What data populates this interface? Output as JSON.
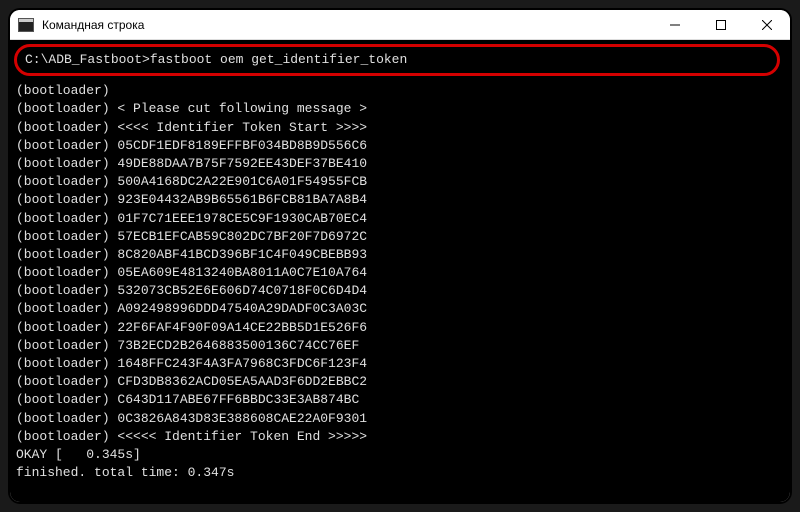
{
  "window": {
    "title": "Командная строка"
  },
  "prompt": {
    "path": "C:\\ADB_Fastboot>",
    "command": "fastboot oem get_identifier_token"
  },
  "output": {
    "lines": [
      "(bootloader) ",
      "(bootloader) < Please cut following message >",
      "(bootloader) <<<< Identifier Token Start >>>>",
      "(bootloader) 05CDF1EDF8189EFFBF034BD8B9D556C6",
      "(bootloader) 49DE88DAA7B75F7592EE43DEF37BE410",
      "(bootloader) 500A4168DC2A22E901C6A01F54955FCB",
      "(bootloader) 923E04432AB9B65561B6FCB81BA7A8B4",
      "(bootloader) 01F7C71EEE1978CE5C9F1930CAB70EC4",
      "(bootloader) 57ECB1EFCAB59C802DC7BF20F7D6972C",
      "(bootloader) 8C820ABF41BCD396BF1C4F049CBEBB93",
      "(bootloader) 05EA609E4813240BA8011A0C7E10A764",
      "(bootloader) 532073CB52E6E606D74C0718F0C6D4D4",
      "(bootloader) A092498996DDD47540A29DADF0C3A03C",
      "(bootloader) 22F6FAF4F90F09A14CE22BB5D1E526F6",
      "(bootloader) 73B2ECD2B2646883500136C74CC76EF",
      "(bootloader) 1648FFC243F4A3FA7968C3FDC6F123F4",
      "(bootloader) CFD3DB8362ACD05EA5AAD3F6DD2EBBC2",
      "(bootloader) C643D117ABE67FF6BBDC33E3AB874BC",
      "(bootloader) 0C3826A843D83E388608CAE22A0F9301",
      "(bootloader) <<<<< Identifier Token End >>>>>",
      "OKAY [   0.345s]",
      "finished. total time: 0.347s"
    ]
  }
}
